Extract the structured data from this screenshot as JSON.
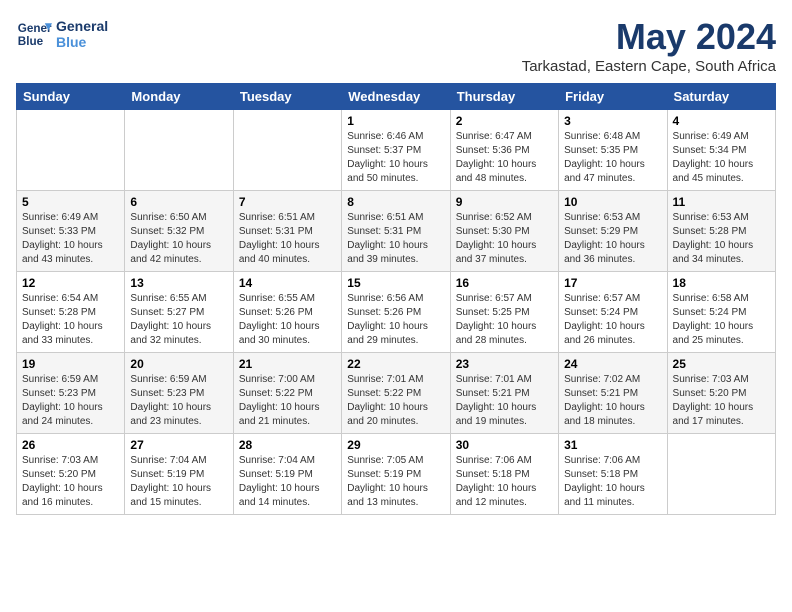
{
  "logo": {
    "line1": "General",
    "line2": "Blue"
  },
  "title": "May 2024",
  "location": "Tarkastad, Eastern Cape, South Africa",
  "weekdays": [
    "Sunday",
    "Monday",
    "Tuesday",
    "Wednesday",
    "Thursday",
    "Friday",
    "Saturday"
  ],
  "weeks": [
    [
      {
        "day": "",
        "info": ""
      },
      {
        "day": "",
        "info": ""
      },
      {
        "day": "",
        "info": ""
      },
      {
        "day": "1",
        "sunrise": "6:46 AM",
        "sunset": "5:37 PM",
        "daylight": "10 hours and 50 minutes."
      },
      {
        "day": "2",
        "sunrise": "6:47 AM",
        "sunset": "5:36 PM",
        "daylight": "10 hours and 48 minutes."
      },
      {
        "day": "3",
        "sunrise": "6:48 AM",
        "sunset": "5:35 PM",
        "daylight": "10 hours and 47 minutes."
      },
      {
        "day": "4",
        "sunrise": "6:49 AM",
        "sunset": "5:34 PM",
        "daylight": "10 hours and 45 minutes."
      }
    ],
    [
      {
        "day": "5",
        "sunrise": "6:49 AM",
        "sunset": "5:33 PM",
        "daylight": "10 hours and 43 minutes."
      },
      {
        "day": "6",
        "sunrise": "6:50 AM",
        "sunset": "5:32 PM",
        "daylight": "10 hours and 42 minutes."
      },
      {
        "day": "7",
        "sunrise": "6:51 AM",
        "sunset": "5:31 PM",
        "daylight": "10 hours and 40 minutes."
      },
      {
        "day": "8",
        "sunrise": "6:51 AM",
        "sunset": "5:31 PM",
        "daylight": "10 hours and 39 minutes."
      },
      {
        "day": "9",
        "sunrise": "6:52 AM",
        "sunset": "5:30 PM",
        "daylight": "10 hours and 37 minutes."
      },
      {
        "day": "10",
        "sunrise": "6:53 AM",
        "sunset": "5:29 PM",
        "daylight": "10 hours and 36 minutes."
      },
      {
        "day": "11",
        "sunrise": "6:53 AM",
        "sunset": "5:28 PM",
        "daylight": "10 hours and 34 minutes."
      }
    ],
    [
      {
        "day": "12",
        "sunrise": "6:54 AM",
        "sunset": "5:28 PM",
        "daylight": "10 hours and 33 minutes."
      },
      {
        "day": "13",
        "sunrise": "6:55 AM",
        "sunset": "5:27 PM",
        "daylight": "10 hours and 32 minutes."
      },
      {
        "day": "14",
        "sunrise": "6:55 AM",
        "sunset": "5:26 PM",
        "daylight": "10 hours and 30 minutes."
      },
      {
        "day": "15",
        "sunrise": "6:56 AM",
        "sunset": "5:26 PM",
        "daylight": "10 hours and 29 minutes."
      },
      {
        "day": "16",
        "sunrise": "6:57 AM",
        "sunset": "5:25 PM",
        "daylight": "10 hours and 28 minutes."
      },
      {
        "day": "17",
        "sunrise": "6:57 AM",
        "sunset": "5:24 PM",
        "daylight": "10 hours and 26 minutes."
      },
      {
        "day": "18",
        "sunrise": "6:58 AM",
        "sunset": "5:24 PM",
        "daylight": "10 hours and 25 minutes."
      }
    ],
    [
      {
        "day": "19",
        "sunrise": "6:59 AM",
        "sunset": "5:23 PM",
        "daylight": "10 hours and 24 minutes."
      },
      {
        "day": "20",
        "sunrise": "6:59 AM",
        "sunset": "5:23 PM",
        "daylight": "10 hours and 23 minutes."
      },
      {
        "day": "21",
        "sunrise": "7:00 AM",
        "sunset": "5:22 PM",
        "daylight": "10 hours and 21 minutes."
      },
      {
        "day": "22",
        "sunrise": "7:01 AM",
        "sunset": "5:22 PM",
        "daylight": "10 hours and 20 minutes."
      },
      {
        "day": "23",
        "sunrise": "7:01 AM",
        "sunset": "5:21 PM",
        "daylight": "10 hours and 19 minutes."
      },
      {
        "day": "24",
        "sunrise": "7:02 AM",
        "sunset": "5:21 PM",
        "daylight": "10 hours and 18 minutes."
      },
      {
        "day": "25",
        "sunrise": "7:03 AM",
        "sunset": "5:20 PM",
        "daylight": "10 hours and 17 minutes."
      }
    ],
    [
      {
        "day": "26",
        "sunrise": "7:03 AM",
        "sunset": "5:20 PM",
        "daylight": "10 hours and 16 minutes."
      },
      {
        "day": "27",
        "sunrise": "7:04 AM",
        "sunset": "5:19 PM",
        "daylight": "10 hours and 15 minutes."
      },
      {
        "day": "28",
        "sunrise": "7:04 AM",
        "sunset": "5:19 PM",
        "daylight": "10 hours and 14 minutes."
      },
      {
        "day": "29",
        "sunrise": "7:05 AM",
        "sunset": "5:19 PM",
        "daylight": "10 hours and 13 minutes."
      },
      {
        "day": "30",
        "sunrise": "7:06 AM",
        "sunset": "5:18 PM",
        "daylight": "10 hours and 12 minutes."
      },
      {
        "day": "31",
        "sunrise": "7:06 AM",
        "sunset": "5:18 PM",
        "daylight": "10 hours and 11 minutes."
      },
      {
        "day": "",
        "info": ""
      }
    ]
  ]
}
